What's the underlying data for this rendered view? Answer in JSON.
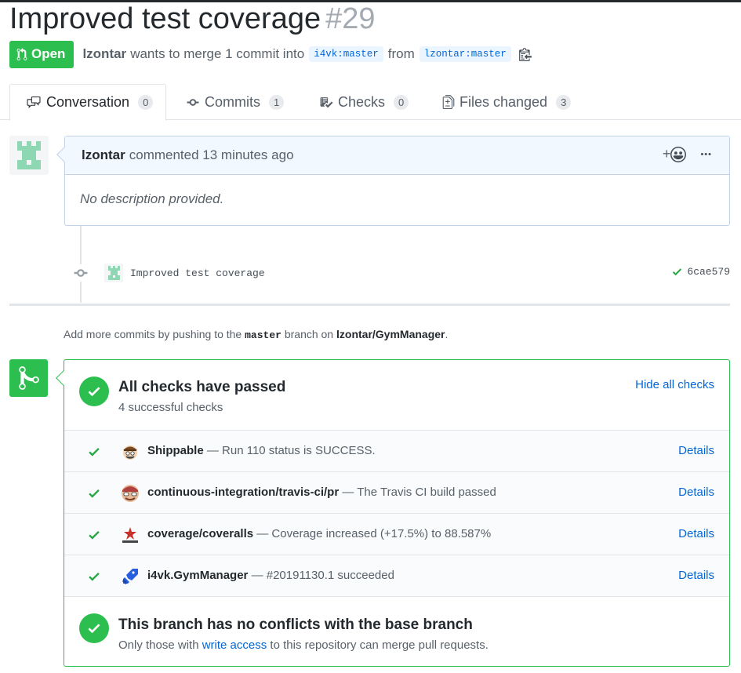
{
  "pr": {
    "title": "Improved test coverage",
    "number": "#29",
    "state": "Open",
    "author": "lzontar",
    "merge_text_1": "wants to merge 1 commit into",
    "base_branch": "i4vk:master",
    "merge_text_2": "from",
    "head_branch": "lzontar:master"
  },
  "tabs": [
    {
      "label": "Conversation",
      "count": "0",
      "icon": "comment-discussion-icon"
    },
    {
      "label": "Commits",
      "count": "1",
      "icon": "git-commit-icon"
    },
    {
      "label": "Checks",
      "count": "0",
      "icon": "checklist-icon"
    },
    {
      "label": "Files changed",
      "count": "3",
      "icon": "file-diff-icon"
    }
  ],
  "comment": {
    "author": "lzontar",
    "meta": "commented 13 minutes ago",
    "body": "No description provided.",
    "reaction": "+",
    "more": "•••"
  },
  "commit": {
    "message": "Improved test coverage",
    "sha": "6cae579"
  },
  "push_hint": {
    "prefix": "Add more commits by pushing to the",
    "branch": "master",
    "middle": "branch on",
    "repo": "lzontar/GymManager",
    "suffix": "."
  },
  "checks": {
    "title": "All checks have passed",
    "subtitle": "4 successful checks",
    "hide_label": "Hide all checks",
    "details_label": "Details",
    "items": [
      {
        "name": "Shippable",
        "desc": "— Run 110 status is SUCCESS.",
        "icon": "shippable-icon"
      },
      {
        "name": "continuous-integration/travis-ci/pr",
        "desc": "— The Travis CI build passed",
        "icon": "travis-icon"
      },
      {
        "name": "coverage/coveralls",
        "desc": "— Coverage increased (+17.5%) to 88.587%",
        "icon": "coveralls-icon"
      },
      {
        "name": "i4vk.GymManager",
        "desc": "— #20191130.1 succeeded",
        "icon": "azure-pipelines-icon"
      }
    ]
  },
  "conflicts": {
    "title": "This branch has no conflicts with the base branch",
    "prefix": "Only those with",
    "link": "write access",
    "suffix": "to this repository can merge pull requests."
  },
  "colors": {
    "success": "#2cbe4e",
    "link": "#0366d6",
    "muted": "#586069"
  }
}
